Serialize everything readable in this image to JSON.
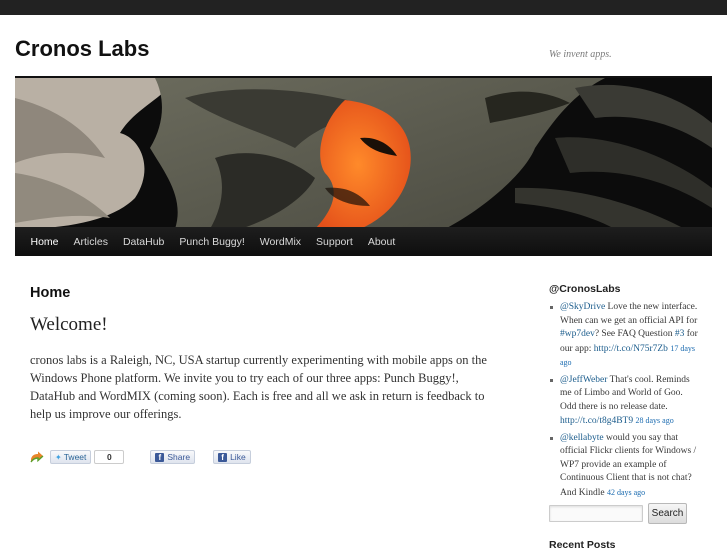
{
  "site": {
    "title": "Cronos Labs",
    "tagline": "We invent apps."
  },
  "nav": {
    "items": [
      {
        "label": "Home",
        "active": true
      },
      {
        "label": "Articles"
      },
      {
        "label": "DataHub"
      },
      {
        "label": "Punch Buggy!"
      },
      {
        "label": "WordMix"
      },
      {
        "label": "Support"
      },
      {
        "label": "About"
      }
    ]
  },
  "main": {
    "heading": "Home",
    "welcome": "Welcome!",
    "intro": "cronos labs is a Raleigh, NC, USA startup currently experimenting with mobile apps on the Windows Phone platform. We invite you to try each of our three apps: Punch Buggy!, DataHub and WordMIX (coming soon). Each is free and all we ask in return is feedback to help us improve our offerings."
  },
  "share": {
    "tweet_label": "Tweet",
    "tweet_count": "0",
    "fb_share_label": "Share",
    "fb_like_label": "Like"
  },
  "sidebar": {
    "twitter_title": "@CronosLabs",
    "tweets": [
      {
        "user": "@SkyDrive",
        "text1": " Love the new interface. When can we get an official API for ",
        "hashtag": "#wp7dev",
        "text2": "? See FAQ Question ",
        "num": "#3",
        "text3": " for our app: ",
        "link": "http://t.co/N75r7Zb",
        "ago": "17 days ago"
      },
      {
        "user": "@JeffWeber",
        "text1": " That's cool. Reminds me of Limbo and World of Goo. Odd there is no release date. ",
        "link": "http://t.co/t8g4BT9",
        "ago": "28 days ago"
      },
      {
        "user": "@kellabyte",
        "text1": " would you say that official Flickr clients for Windows / WP7 provide an example of Continuous Client that is not chat? And Kindle ",
        "ago": "42 days ago"
      }
    ],
    "search_button": "Search",
    "recent_posts_title": "Recent Posts"
  },
  "colors": {
    "topbar": "#222222",
    "nav_bg": "#111111",
    "link": "#1b5c8c",
    "accent_orange": "#f26a1b"
  }
}
